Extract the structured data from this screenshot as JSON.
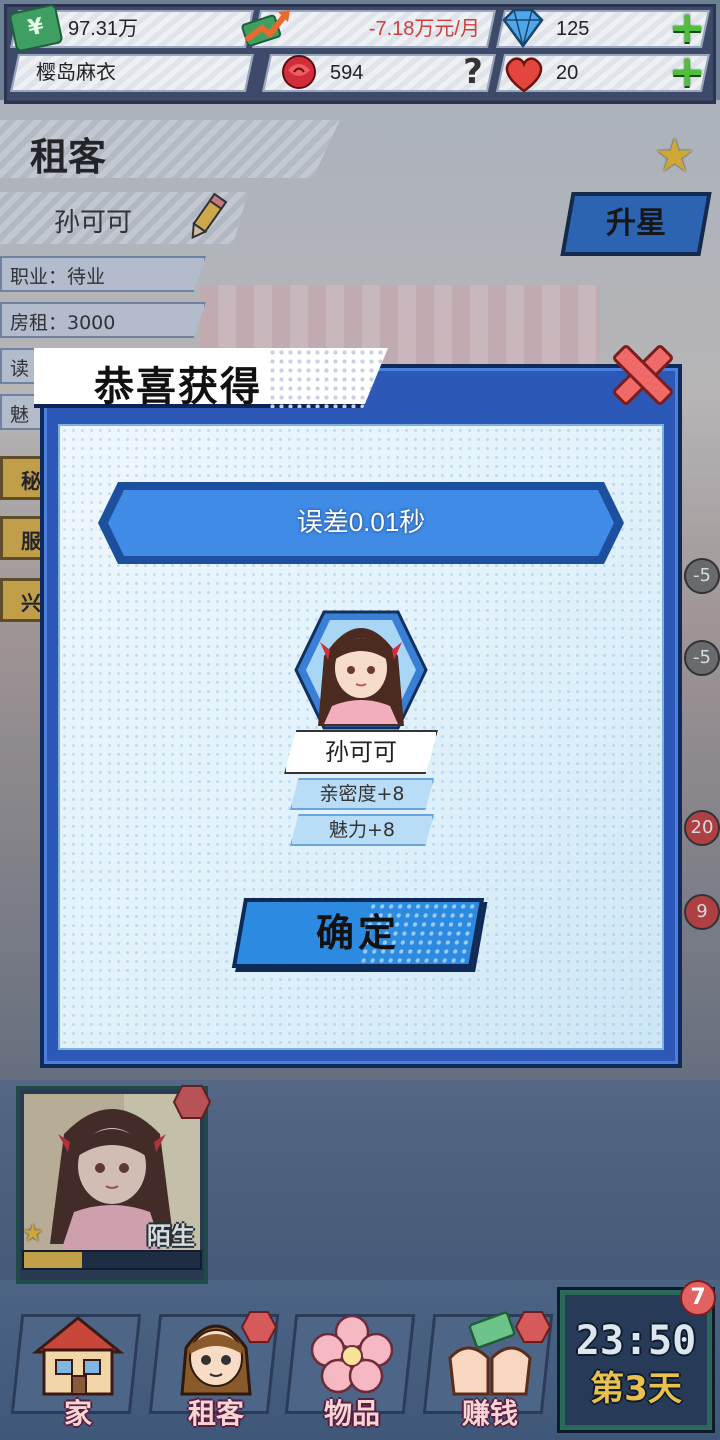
{
  "status_bar": {
    "money": "97.31万",
    "monthly_change": "-7.18万元/月",
    "diamonds": "125",
    "player_name": "樱岛麻衣",
    "roses": "594",
    "hearts": "20"
  },
  "tenant_panel": {
    "section_title": "租客",
    "tenant_name": "孙可可",
    "upgrade_label": "升星",
    "info_rows": [
      "职业：待业",
      "房租：3000",
      "读",
      "魅"
    ],
    "side_tabs": [
      "秘",
      "服",
      "兴"
    ],
    "right_badges": [
      "-5",
      "-5",
      "20",
      "9"
    ]
  },
  "modal": {
    "title": "恭喜获得",
    "result_text": "误差0.01秒",
    "reward_name": "孙可可",
    "stats": [
      "亲密度+8",
      "魅力+8"
    ],
    "confirm_label": "确定"
  },
  "character_card": {
    "status_label": "陌生",
    "level_stars": 1,
    "progress": 0.33
  },
  "bottom_nav": {
    "items": [
      {
        "label": "家",
        "icon": "house-icon"
      },
      {
        "label": "租客",
        "icon": "tenant-avatar-icon"
      },
      {
        "label": "物品",
        "icon": "flower-icon"
      },
      {
        "label": "赚钱",
        "icon": "money-hands-icon"
      }
    ]
  },
  "clock": {
    "time": "23:50",
    "day": "第3天",
    "badge": "7"
  },
  "colors": {
    "modal_blue": "#2c58b7",
    "banner_blue": "#3f8be6",
    "close_red": "#f06a6a",
    "plus_green": "#4fbf3d"
  }
}
